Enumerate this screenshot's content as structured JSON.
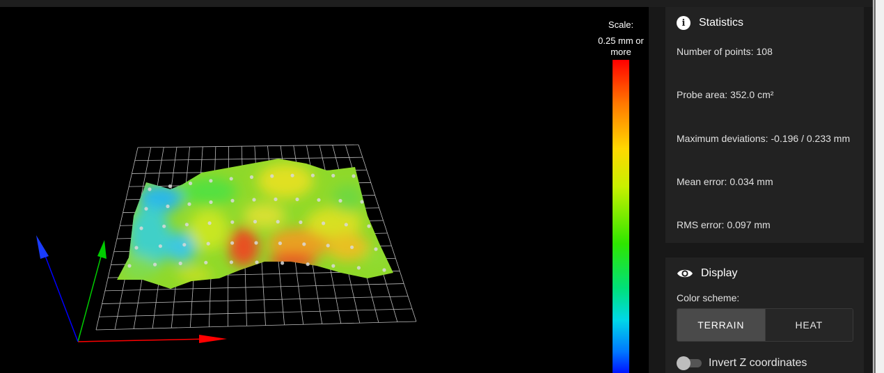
{
  "scale": {
    "label": "Scale:",
    "value": "0.25 mm or more",
    "gradient_colors": [
      "#ff0000",
      "#ff7a00",
      "#ffd800",
      "#2ee600",
      "#00d8e8",
      "#0000ff"
    ]
  },
  "statistics": {
    "title": "Statistics",
    "icon": "info-icon",
    "lines": [
      {
        "label": "Number of points:",
        "value": "108"
      },
      {
        "label": "Probe area:",
        "value": "352.0 cm²"
      },
      {
        "label": "Maximum deviations:",
        "value": "-0.196 / 0.233 mm"
      },
      {
        "label": "Mean error:",
        "value": "0.034 mm"
      },
      {
        "label": "RMS error:",
        "value": "0.097 mm"
      }
    ]
  },
  "display": {
    "title": "Display",
    "icon": "eye-icon",
    "color_scheme_label": "Color scheme:",
    "buttons": [
      {
        "label": "TERRAIN",
        "active": true
      },
      {
        "label": "HEAT",
        "active": false
      }
    ],
    "toggle": {
      "label": "Invert Z coordinates",
      "checked": false
    }
  },
  "axes": {
    "x_color": "#ff0000",
    "y_color": "#00cc00",
    "z_color": "#0000ff"
  }
}
